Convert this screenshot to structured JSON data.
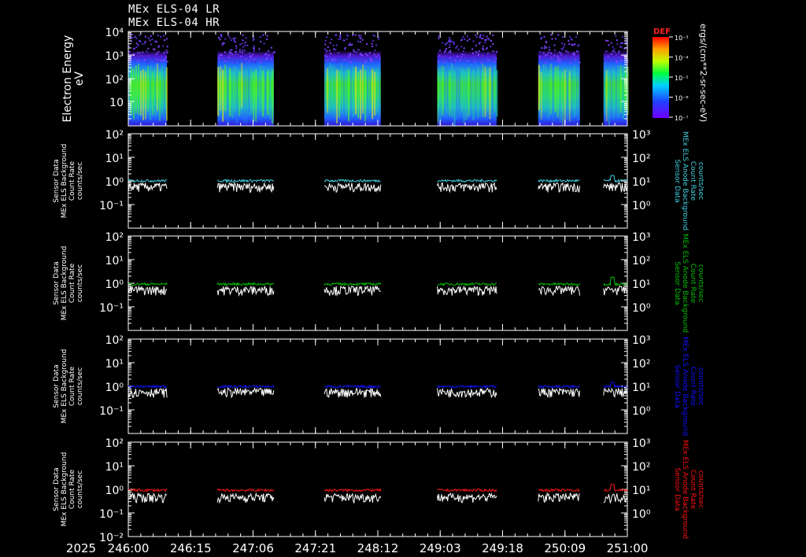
{
  "header": {
    "line1": "MEx ELS-04 LR",
    "line2": "MEx ELS-04 HR"
  },
  "colors": {
    "background": "#000000",
    "axis": "#ffffff",
    "trace_white": "#ffffff",
    "cyan": "#40d0e0",
    "green": "#00c000",
    "blue": "#1010ff",
    "red": "#ff1010"
  },
  "colorbar": {
    "title": "DEF",
    "unit_label": "ergs/(cm**2-sr-sec-eV)",
    "tick_labels": [
      "10⁻³",
      "10⁻⁴",
      "10⁻⁵",
      "10⁻⁶",
      "10⁻⁷"
    ],
    "colormap": "rainbow"
  },
  "time_axis": {
    "year_label": "2025",
    "tick_labels": [
      "246:00",
      "246:15",
      "247:06",
      "247:21",
      "248:12",
      "249:03",
      "249:18",
      "250:09",
      "251:00"
    ]
  },
  "chart_data": [
    {
      "type": "heatmap",
      "ylabel": "Electron Energy",
      "yunits": "eV",
      "y_scale": "log",
      "ylim": [
        2,
        10000
      ],
      "y_tick_labels": [
        "10⁴",
        "10³",
        "10²",
        "10"
      ],
      "data_segments_time_hours": [
        [
          0,
          13
        ],
        [
          30,
          49
        ],
        [
          66,
          85
        ],
        [
          104,
          124
        ],
        [
          138,
          152
        ],
        [
          160,
          168
        ]
      ]
    },
    {
      "type": "line",
      "ylabel": [
        "Sensor Data",
        "MEx ELS Background",
        "Count Rate",
        "counts/sec"
      ],
      "right_label": [
        "Sensor Data",
        "MEx ELS Anode Background",
        "Count Rate",
        "counts/sec"
      ],
      "right_color": "#40d0e0",
      "y_scale": "log",
      "ylim": [
        0.1,
        100
      ],
      "y2lim": [
        1,
        1000
      ],
      "y_tick_labels": [
        "10²",
        "10¹",
        "10⁰",
        "10⁻¹"
      ],
      "y2_tick_labels": [
        "10³",
        "10²",
        "10¹",
        "10⁰"
      ],
      "series": [
        {
          "color": "#40d0e0",
          "level": 1.0,
          "spike_at_hours": 163,
          "spike_value": 1.7
        },
        {
          "color": "#ffffff",
          "level": 0.55
        }
      ]
    },
    {
      "type": "line",
      "ylabel": [
        "Sensor Data",
        "MEx ELS Background",
        "Count Rate",
        "counts/sec"
      ],
      "right_label": [
        "Sensor Data",
        "MEx ELS Anode Background",
        "Count Rate",
        "counts/sec"
      ],
      "right_color": "#00c000",
      "y_scale": "log",
      "ylim": [
        0.1,
        100
      ],
      "y2lim": [
        1,
        1000
      ],
      "y_tick_labels": [
        "10²",
        "10¹",
        "10⁰",
        "10⁻¹"
      ],
      "y2_tick_labels": [
        "10³",
        "10²",
        "10¹",
        "10⁰"
      ],
      "series": [
        {
          "color": "#00c000",
          "level": 0.9,
          "spike_at_hours": 163,
          "spike_value": 1.8
        },
        {
          "color": "#ffffff",
          "level": 0.5
        }
      ]
    },
    {
      "type": "line",
      "ylabel": [
        "Sensor Data",
        "MEx ELS Background",
        "Count Rate",
        "counts/sec"
      ],
      "right_label": [
        "Sensor Data",
        "MEx ELS Anode Background",
        "Count Rate",
        "counts/sec"
      ],
      "right_color": "#1010ff",
      "y_scale": "log",
      "ylim": [
        0.1,
        100
      ],
      "y2lim": [
        1,
        1000
      ],
      "y_tick_labels": [
        "10²",
        "10¹",
        "10⁰",
        "10⁻¹"
      ],
      "y2_tick_labels": [
        "10³",
        "10²",
        "10¹",
        "10⁰"
      ],
      "series": [
        {
          "color": "#1010ff",
          "level": 0.95,
          "spike_at_hours": 163,
          "spike_value": 1.5
        },
        {
          "color": "#ffffff",
          "level": 0.55
        }
      ]
    },
    {
      "type": "line",
      "ylabel": [
        "Sensor Data",
        "MEx ELS Background",
        "Count Rate",
        "counts/sec"
      ],
      "right_label": [
        "Sensor Data",
        "MEx ELS Anode Background",
        "Count Rate",
        "counts/sec"
      ],
      "right_color": "#ff1010",
      "y_scale": "log",
      "ylim": [
        0.1,
        100
      ],
      "y2lim": [
        1,
        1000
      ],
      "y_tick_labels": [
        "10²",
        "10¹",
        "10⁰",
        "10⁻¹",
        "10⁻²"
      ],
      "y2_tick_labels": [
        "10³",
        "10²",
        "10¹",
        "10⁰"
      ],
      "series": [
        {
          "color": "#ff1010",
          "level": 0.9,
          "spike_at_hours": 163,
          "spike_value": 1.6
        },
        {
          "color": "#ffffff",
          "level": 0.45
        }
      ]
    }
  ]
}
